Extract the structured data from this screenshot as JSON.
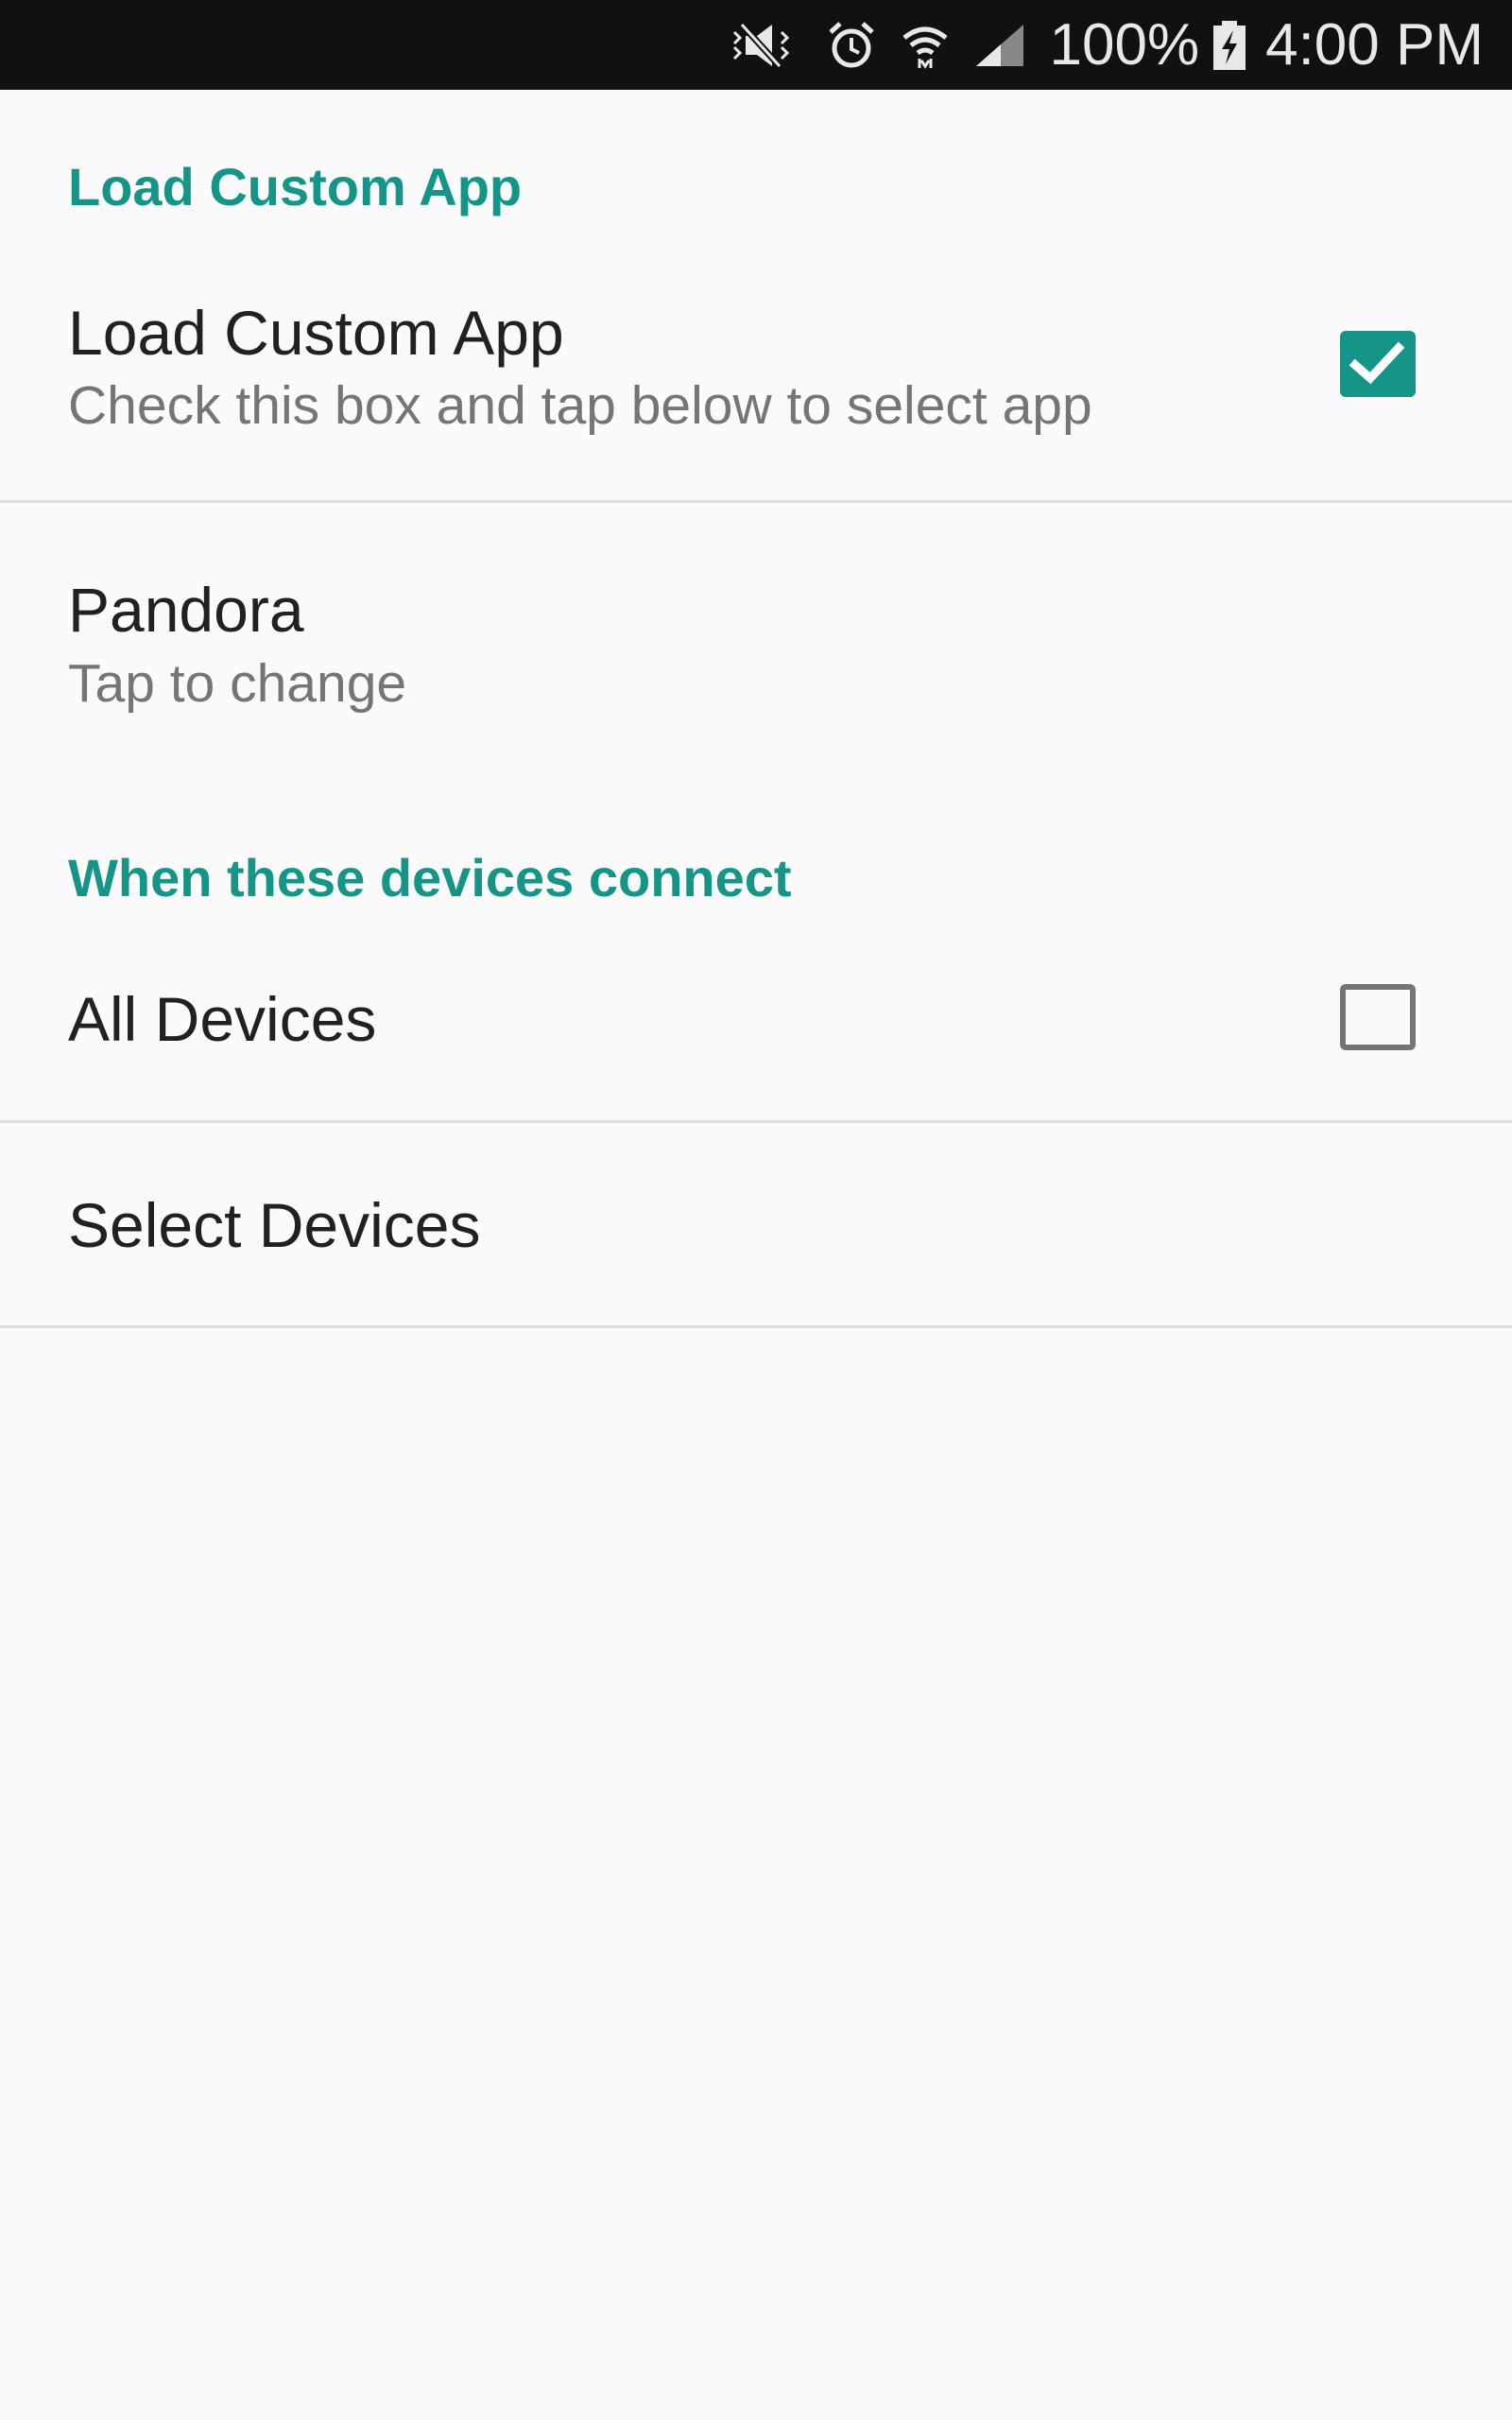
{
  "status_bar": {
    "icons": [
      "mute-icon",
      "alarm-icon",
      "wifi-icon",
      "signal-icon",
      "battery-charging-icon"
    ],
    "battery_text": "100%",
    "time": "4:00 PM"
  },
  "accent_color": "#159488",
  "sections": {
    "load_custom_app": {
      "header": "Load Custom App",
      "toggle_item": {
        "title": "Load Custom App",
        "summary": "Check this box and tap below to select app",
        "checked": true
      },
      "app_item": {
        "title": "Pandora",
        "summary": "Tap to change"
      }
    },
    "devices": {
      "header": "When these devices connect",
      "all_devices": {
        "title": "All Devices",
        "checked": false
      },
      "select_devices": {
        "title": "Select Devices"
      }
    }
  }
}
